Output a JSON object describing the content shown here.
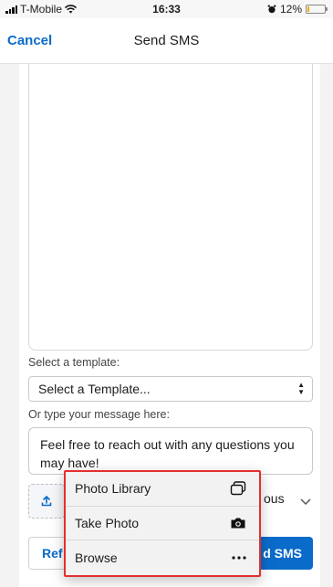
{
  "status_bar": {
    "carrier": "T-Mobile",
    "time": "16:33",
    "battery": "12%",
    "battery_level": 0.12
  },
  "nav": {
    "cancel_label": "Cancel",
    "title": "Send SMS"
  },
  "form": {
    "template_label": "Select a template:",
    "template_value": "Select a Template...",
    "message_label": "Or type your message here:",
    "message_value": "Feel free to reach out with any questions you may have!",
    "partial_text": "ous",
    "refresh_label": "Ref",
    "send_label": "d SMS"
  },
  "attach_menu": {
    "items": [
      {
        "label": "Photo Library",
        "icon": "photo-library-icon"
      },
      {
        "label": "Take Photo",
        "icon": "camera-icon"
      },
      {
        "label": "Browse",
        "icon": "more-icon"
      }
    ]
  },
  "colors": {
    "accent": "#0b6bcb",
    "highlight": "#e62e2e",
    "battery_low": "#f0a500"
  }
}
